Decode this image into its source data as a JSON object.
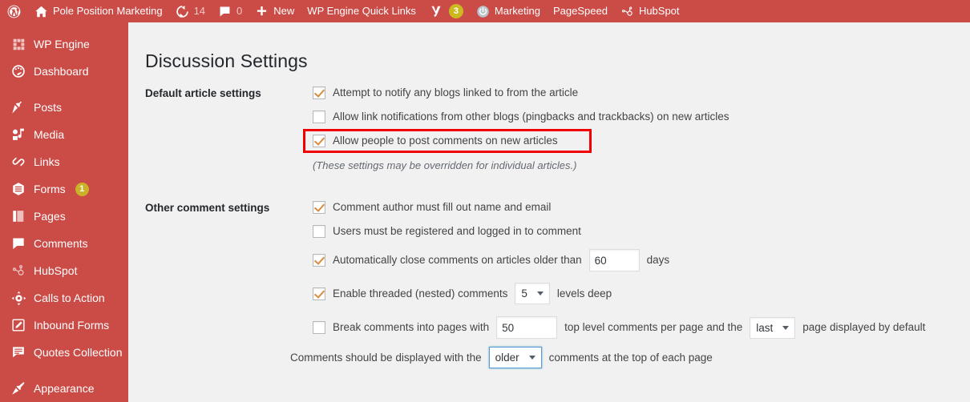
{
  "theme": {
    "admin_red": "#cb4b47",
    "content_bg": "#f1f1f1",
    "checkmark_orange": "#d98c3e",
    "highlight_red": "#f00000",
    "badge_yellow": "#c9b227",
    "focus_blue": "#5b9dd9"
  },
  "adminbar": {
    "items": [
      {
        "icon": "wordpress-logo-icon",
        "label": ""
      },
      {
        "icon": "home-icon",
        "label": "Pole Position Marketing"
      },
      {
        "icon": "updates-icon",
        "label": "14"
      },
      {
        "icon": "comment-bubble-icon",
        "label": "0"
      },
      {
        "icon": "plus-icon",
        "label": "New"
      },
      {
        "icon": "",
        "label": "WP Engine Quick Links"
      },
      {
        "icon": "yoast-icon",
        "label": "",
        "badge": "3"
      },
      {
        "icon": "power-circle-icon",
        "label": "Marketing"
      },
      {
        "icon": "",
        "label": "PageSpeed"
      },
      {
        "icon": "hubspot-icon",
        "label": "HubSpot"
      }
    ]
  },
  "sidebar": {
    "items": [
      {
        "icon": "wpengine-grid-icon",
        "label": "WP Engine"
      },
      {
        "icon": "dashboard-gauge-icon",
        "label": "Dashboard"
      },
      {
        "icon": "posts-pin-icon",
        "label": "Posts",
        "gap_before": true
      },
      {
        "icon": "media-icon",
        "label": "Media"
      },
      {
        "icon": "links-chain-icon",
        "label": "Links"
      },
      {
        "icon": "forms-icon",
        "label": "Forms",
        "badge": "1"
      },
      {
        "icon": "pages-icon",
        "label": "Pages"
      },
      {
        "icon": "comments-bubble-icon",
        "label": "Comments"
      },
      {
        "icon": "hubspot-sprocket-icon",
        "label": "HubSpot"
      },
      {
        "icon": "calls-to-action-icon",
        "label": "Calls to Action"
      },
      {
        "icon": "inbound-forms-icon",
        "label": "Inbound Forms"
      },
      {
        "icon": "quotes-collection-icon",
        "label": "Quotes Collection"
      },
      {
        "icon": "appearance-brush-icon",
        "label": "Appearance",
        "gap_before": true
      }
    ]
  },
  "page": {
    "title": "Discussion Settings",
    "sections": {
      "default_article": {
        "label": "Default article settings",
        "options": [
          {
            "checked": true,
            "text": "Attempt to notify any blogs linked to from the article"
          },
          {
            "checked": false,
            "text": "Allow link notifications from other blogs (pingbacks and trackbacks) on new articles"
          },
          {
            "checked": true,
            "text": "Allow people to post comments on new articles",
            "highlighted": true
          }
        ],
        "note": "(These settings may be overridden for individual articles.)"
      },
      "other_comment": {
        "label": "Other comment settings",
        "options": [
          {
            "checked": true,
            "text": "Comment author must fill out name and email"
          },
          {
            "checked": false,
            "text": "Users must be registered and logged in to comment"
          }
        ],
        "auto_close": {
          "checked": true,
          "text_before": "Automatically close comments on articles older than",
          "value": "60",
          "text_after": "days"
        },
        "threaded": {
          "checked": true,
          "text_before": "Enable threaded (nested) comments",
          "value": "5",
          "text_after": "levels deep"
        },
        "paging": {
          "checked": false,
          "text_before": "Break comments into pages with",
          "value": "50",
          "text_mid": "top level comments per page and the",
          "select_value": "last",
          "text_after": "page displayed by default"
        },
        "order": {
          "text_before": "Comments should be displayed with the",
          "select_value": "older",
          "text_after": "comments at the top of each page"
        }
      }
    }
  }
}
